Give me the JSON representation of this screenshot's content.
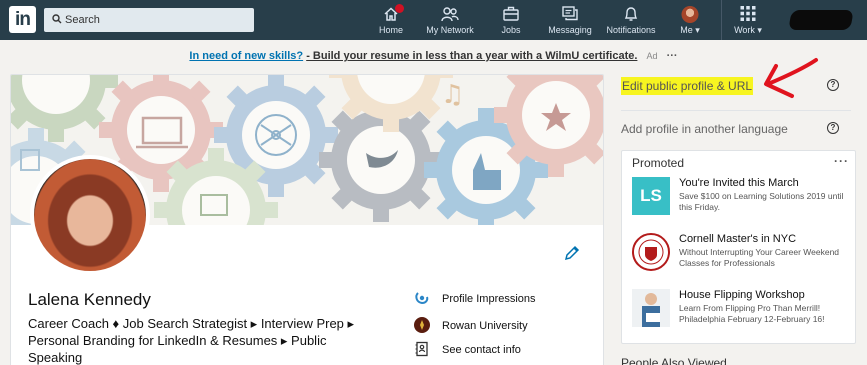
{
  "nav": {
    "logo": "in",
    "search_placeholder": "Search",
    "items": [
      {
        "label": "Home",
        "icon": "home-icon"
      },
      {
        "label": "My Network",
        "icon": "network-icon"
      },
      {
        "label": "Jobs",
        "icon": "briefcase-icon"
      },
      {
        "label": "Messaging",
        "icon": "messaging-icon"
      },
      {
        "label": "Notifications",
        "icon": "bell-icon"
      },
      {
        "label": "Me ▾",
        "icon": "avatar"
      },
      {
        "label": "Work ▾",
        "icon": "grid-icon"
      }
    ],
    "colors": {
      "bar": "#283e4a",
      "badge": "#d11124"
    }
  },
  "ad": {
    "link_text": "In need of new skills?",
    "rest_text": "- Build your resume in less than a year with a WilmU certificate.",
    "ad_label": "Ad",
    "more": "···"
  },
  "profile": {
    "name": "Lalena Kennedy",
    "headline": "Career Coach ♦ Job Search Strategist ▸ Interview Prep ▸ Personal Branding for LinkedIn & Resumes ▸ Public Speaking",
    "links": [
      {
        "label": "Profile Impressions",
        "icon": "impressions-icon"
      },
      {
        "label": "Rowan University",
        "icon": "university-logo"
      },
      {
        "label": "See contact info",
        "icon": "contact-card-icon"
      }
    ]
  },
  "sidebar": {
    "edit_profile": "Edit public profile & URL",
    "add_language": "Add profile in another language",
    "help": "?",
    "highlight_color": "#f7f520",
    "arrow_color": "#e0141e"
  },
  "promoted": {
    "title": "Promoted",
    "more": "···",
    "items": [
      {
        "title": "You're Invited this March",
        "desc": "Save $100 on Learning Solutions 2019 until this Friday.",
        "thumb_text": "LS"
      },
      {
        "title": "Cornell Master's in NYC",
        "desc": "Without Interrupting Your Career Weekend Classes for Professionals",
        "thumb_text": ""
      },
      {
        "title": "House Flipping Workshop",
        "desc": "Learn From Flipping Pro Than Merrill! Philadelphia February 12-February 16!",
        "thumb_text": ""
      }
    ]
  },
  "people_also_viewed": "People Also Viewed"
}
